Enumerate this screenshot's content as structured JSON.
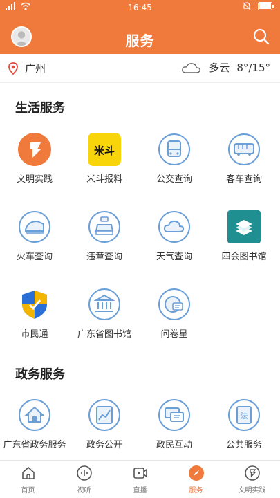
{
  "statusbar": {
    "time": "16:45"
  },
  "header": {
    "title": "服务"
  },
  "location": {
    "city": "广州"
  },
  "weather": {
    "condition": "多云",
    "temp": "8°/15°"
  },
  "sections": {
    "life": "生活服务",
    "gov": "政务服务"
  },
  "life_services": [
    {
      "label": "文明实践",
      "icon": "flag-icon"
    },
    {
      "label": "米斗报料",
      "icon": "midou-logo-icon"
    },
    {
      "label": "公交查询",
      "icon": "bus-icon"
    },
    {
      "label": "客车查询",
      "icon": "coach-icon"
    },
    {
      "label": "火车查询",
      "icon": "train-icon"
    },
    {
      "label": "违章查询",
      "icon": "car-violation-icon"
    },
    {
      "label": "天气查询",
      "icon": "cloud-icon"
    },
    {
      "label": "四会图书馆",
      "icon": "books-icon"
    },
    {
      "label": "市民通",
      "icon": "shield-icon"
    },
    {
      "label": "广东省图书馆",
      "icon": "library-building-icon"
    },
    {
      "label": "问卷星",
      "icon": "survey-icon"
    }
  ],
  "gov_services": [
    {
      "label": "广东省政务服务",
      "icon": "home-icon"
    },
    {
      "label": "政务公开",
      "icon": "chart-icon"
    },
    {
      "label": "政民互动",
      "icon": "chat-icon"
    },
    {
      "label": "公共服务",
      "icon": "law-icon"
    }
  ],
  "tabs": [
    {
      "label": "首页",
      "icon": "home-tab-icon"
    },
    {
      "label": "视听",
      "icon": "audio-tab-icon"
    },
    {
      "label": "直播",
      "icon": "video-tab-icon"
    },
    {
      "label": "服务",
      "icon": "compass-tab-icon"
    },
    {
      "label": "文明实践",
      "icon": "flag-tab-icon"
    }
  ],
  "colors": {
    "brand": "#f07a3c",
    "ring": "#6a9fd8"
  }
}
